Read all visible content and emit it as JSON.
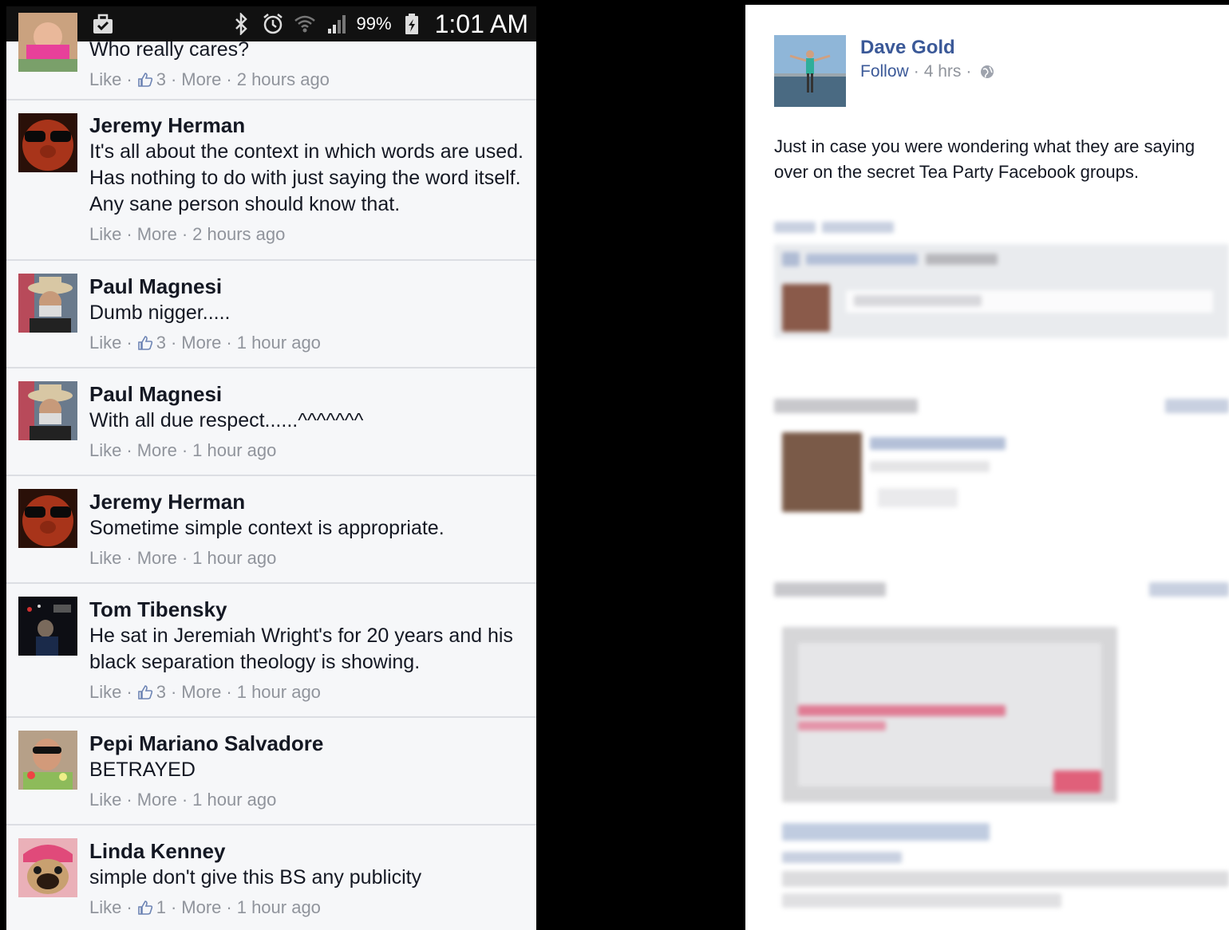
{
  "status_bar": {
    "battery_percent": "99%",
    "time": "1:01 AM",
    "icons": [
      "gallery-icon",
      "kik-icon",
      "briefcase-icon",
      "bluetooth-icon",
      "alarm-icon",
      "wifi-icon",
      "signal-icon",
      "battery-charging-icon"
    ]
  },
  "comments": [
    {
      "name": "",
      "text": "Who really cares?",
      "like_label": "Like",
      "like_count": "3",
      "more_label": "More",
      "time": "2 hours ago",
      "avatar": "pink-baby"
    },
    {
      "name": "Jeremy Herman",
      "text": "It's all about the context in which words are used. Has nothing to do with just saying the word itself. Any sane person should know that.",
      "like_label": "Like",
      "like_count": "",
      "more_label": "More",
      "time": "2 hours ago",
      "avatar": "dark-sunglasses"
    },
    {
      "name": "Paul Magnesi",
      "text": "Dumb nigger.....",
      "like_label": "Like",
      "like_count": "3",
      "more_label": "More",
      "time": "1 hour ago",
      "avatar": "cowboy-hat"
    },
    {
      "name": "Paul Magnesi",
      "text": "With all due respect......^^^^^^^",
      "like_label": "Like",
      "like_count": "",
      "more_label": "More",
      "time": "1 hour ago",
      "avatar": "cowboy-hat"
    },
    {
      "name": "Jeremy Herman",
      "text": "Sometime simple context is appropriate.",
      "like_label": "Like",
      "like_count": "",
      "more_label": "More",
      "time": "1 hour ago",
      "avatar": "dark-sunglasses"
    },
    {
      "name": "Tom Tibensky",
      "text": "He sat in Jeremiah Wright's for 20 years and his black separation theology is showing.",
      "like_label": "Like",
      "like_count": "3",
      "more_label": "More",
      "time": "1 hour ago",
      "avatar": "stage-dark"
    },
    {
      "name": "Pepi Mariano Salvadore",
      "text": "BETRAYED",
      "like_label": "Like",
      "like_count": "",
      "more_label": "More",
      "time": "1 hour ago",
      "avatar": "sunglasses-lei"
    },
    {
      "name": "Linda Kenney",
      "text": "simple don't give this BS any publicity",
      "like_label": "Like",
      "like_count": "1",
      "more_label": "More",
      "time": "1 hour ago",
      "avatar": "pug-pink"
    }
  ],
  "post": {
    "author": "Dave Gold",
    "follow_label": "Follow",
    "time": "4 hrs",
    "privacy_icon": "globe-icon",
    "text": "Just in case you were wondering what they are saying over on the secret Tea Party Facebook groups."
  },
  "colors": {
    "fb_blue": "#3b5998",
    "meta_gray": "#90949c",
    "text_dark": "#141823",
    "phone_bg": "#f6f7f9"
  }
}
